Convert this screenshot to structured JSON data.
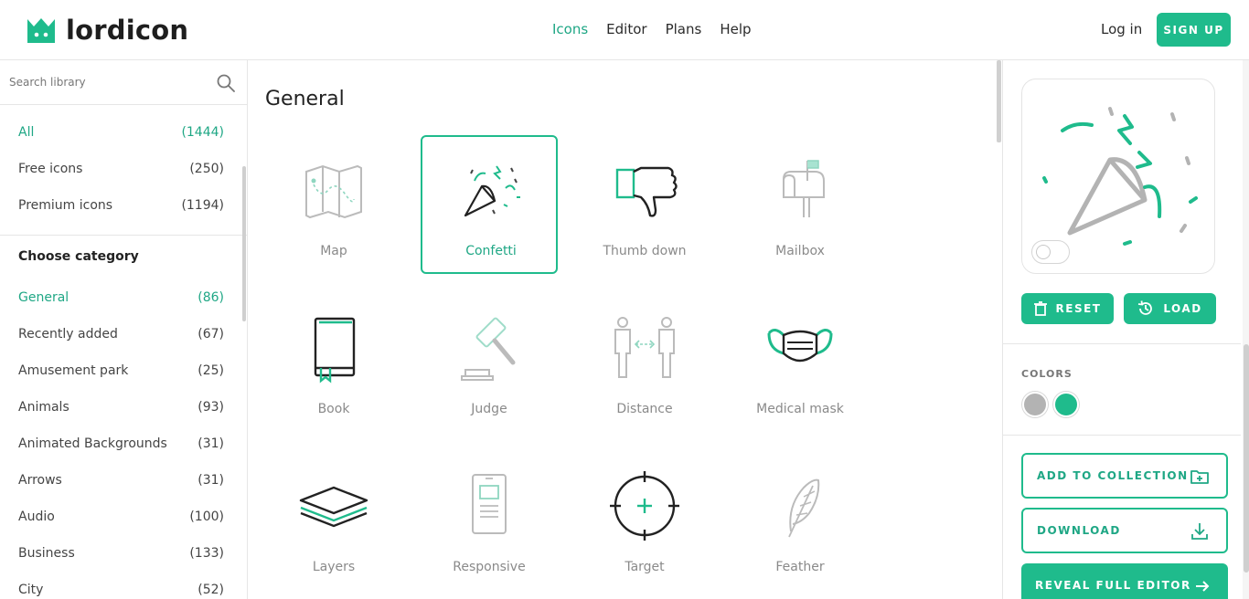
{
  "brand": {
    "name": "lordicon"
  },
  "nav": {
    "items": [
      "Icons",
      "Editor",
      "Plans",
      "Help"
    ],
    "active": "Icons"
  },
  "auth": {
    "login": "Log in",
    "signup": "SIGN UP"
  },
  "search": {
    "placeholder": "Search library"
  },
  "filters": [
    {
      "label": "All",
      "count": "(1444)",
      "active": true
    },
    {
      "label": "Free icons",
      "count": "(250)"
    },
    {
      "label": "Premium icons",
      "count": "(1194)"
    }
  ],
  "categories_heading": "Choose category",
  "categories": [
    {
      "label": "General",
      "count": "(86)",
      "active": true
    },
    {
      "label": "Recently added",
      "count": "(67)"
    },
    {
      "label": "Amusement park",
      "count": "(25)"
    },
    {
      "label": "Animals",
      "count": "(93)"
    },
    {
      "label": "Animated Backgrounds",
      "count": "(31)"
    },
    {
      "label": "Arrows",
      "count": "(31)"
    },
    {
      "label": "Audio",
      "count": "(100)"
    },
    {
      "label": "Business",
      "count": "(133)"
    },
    {
      "label": "City",
      "count": "(52)"
    }
  ],
  "main": {
    "title": "General",
    "icons": [
      {
        "name": "Map",
        "icon": "map-icon"
      },
      {
        "name": "Confetti",
        "icon": "confetti-icon",
        "selected": true
      },
      {
        "name": "Thumb down",
        "icon": "thumb-down-icon"
      },
      {
        "name": "Mailbox",
        "icon": "mailbox-icon"
      },
      {
        "name": "Book",
        "icon": "book-icon"
      },
      {
        "name": "Judge",
        "icon": "gavel-icon"
      },
      {
        "name": "Distance",
        "icon": "distance-icon"
      },
      {
        "name": "Medical mask",
        "icon": "medical-mask-icon"
      },
      {
        "name": "Layers",
        "icon": "layers-icon"
      },
      {
        "name": "Responsive",
        "icon": "responsive-icon"
      },
      {
        "name": "Target",
        "icon": "target-icon"
      },
      {
        "name": "Feather",
        "icon": "feather-icon"
      }
    ]
  },
  "panel": {
    "reset": "RESET",
    "load": "LOAD",
    "colors_label": "COLORS",
    "colors": [
      "#b3b3b3",
      "#1fbb8c"
    ],
    "add_to_collection": "ADD TO COLLECTION",
    "download": "DOWNLOAD",
    "reveal_editor": "REVEAL FULL EDITOR"
  },
  "theme": {
    "accent": "#1fbb8c",
    "accent_text": "#1fa785"
  }
}
